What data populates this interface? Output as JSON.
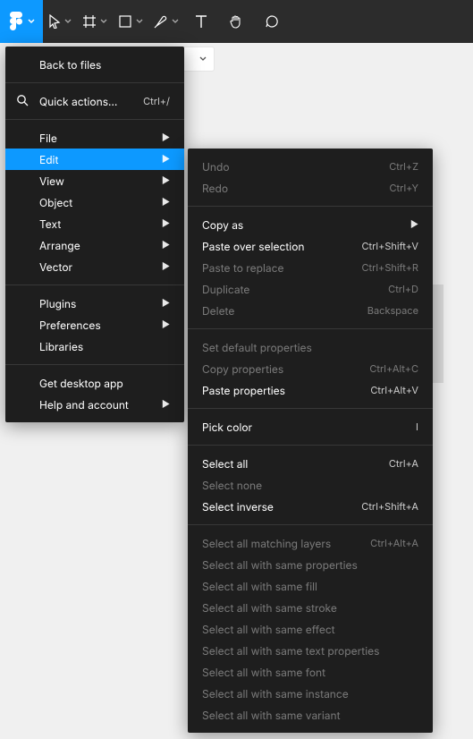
{
  "toolbar": {
    "items": [
      "figma-menu",
      "move-tool",
      "frame-tool",
      "shape-tool",
      "pen-tool",
      "text-tool",
      "hand-tool",
      "comment-tool"
    ]
  },
  "canvas": {
    "dropdown_value": ""
  },
  "main_menu": {
    "back": "Back to files",
    "quick_actions": "Quick actions…",
    "quick_actions_shortcut": "Ctrl+/",
    "file": "File",
    "edit": "Edit",
    "view": "View",
    "object": "Object",
    "text": "Text",
    "arrange": "Arrange",
    "vector": "Vector",
    "plugins": "Plugins",
    "preferences": "Preferences",
    "libraries": "Libraries",
    "desktop": "Get desktop app",
    "help": "Help and account"
  },
  "edit_menu": {
    "undo": {
      "label": "Undo",
      "shortcut": "Ctrl+Z"
    },
    "redo": {
      "label": "Redo",
      "shortcut": "Ctrl+Y"
    },
    "copy_as": {
      "label": "Copy as"
    },
    "paste_over": {
      "label": "Paste over selection",
      "shortcut": "Ctrl+Shift+V"
    },
    "paste_replace": {
      "label": "Paste to replace",
      "shortcut": "Ctrl+Shift+R"
    },
    "duplicate": {
      "label": "Duplicate",
      "shortcut": "Ctrl+D"
    },
    "delete": {
      "label": "Delete",
      "shortcut": "Backspace"
    },
    "set_default": {
      "label": "Set default properties"
    },
    "copy_props": {
      "label": "Copy properties",
      "shortcut": "Ctrl+Alt+C"
    },
    "paste_props": {
      "label": "Paste properties",
      "shortcut": "Ctrl+Alt+V"
    },
    "pick_color": {
      "label": "Pick color",
      "shortcut": "I"
    },
    "select_all": {
      "label": "Select all",
      "shortcut": "Ctrl+A"
    },
    "select_none": {
      "label": "Select none"
    },
    "select_inverse": {
      "label": "Select inverse",
      "shortcut": "Ctrl+Shift+A"
    },
    "sel_matching": {
      "label": "Select all matching layers",
      "shortcut": "Ctrl+Alt+A"
    },
    "sel_props": {
      "label": "Select all with same properties"
    },
    "sel_fill": {
      "label": "Select all with same fill"
    },
    "sel_stroke": {
      "label": "Select all with same stroke"
    },
    "sel_effect": {
      "label": "Select all with same effect"
    },
    "sel_textprops": {
      "label": "Select all with same text properties"
    },
    "sel_font": {
      "label": "Select all with same font"
    },
    "sel_instance": {
      "label": "Select all with same instance"
    },
    "sel_variant": {
      "label": "Select all with same variant"
    }
  }
}
